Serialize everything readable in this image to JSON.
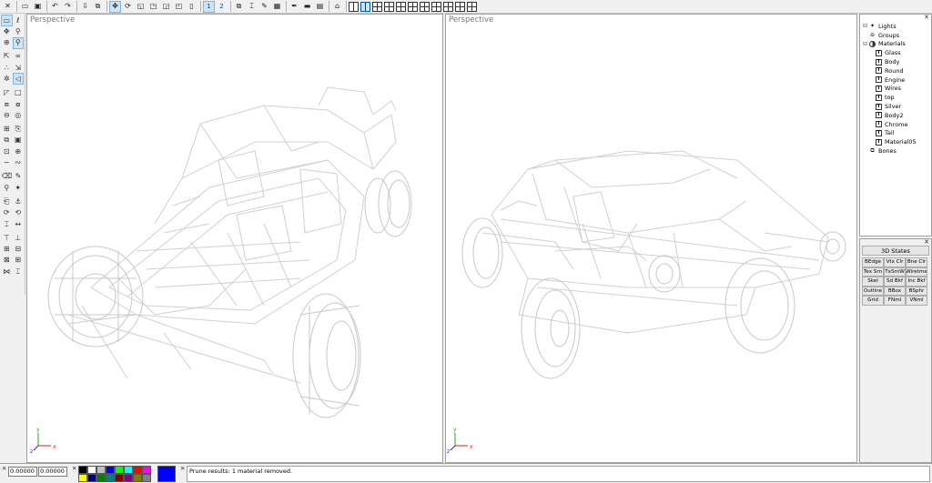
{
  "toolbar": {
    "icons": [
      "close-icon",
      "open-folder-icon",
      "save-icon",
      "undo-icon",
      "redo-icon",
      "import-icon",
      "export-icon",
      "move-icon",
      "rotate-icon",
      "scale-icon",
      "select-icon",
      "deselect-icon",
      "invert-icon",
      "info-icon"
    ],
    "buttons": [
      "1",
      "2"
    ],
    "active_view_button": "1"
  },
  "viewports": {
    "left": {
      "label": "Perspective"
    },
    "right": {
      "label": "Perspective"
    }
  },
  "scene_tree": {
    "lights": "Lights",
    "groups": "Groups",
    "materials": "Materials",
    "material_items": [
      "Glass",
      "Body",
      "Round",
      "Engine",
      "Wires",
      "top",
      "Silver",
      "Body2",
      "Chrome",
      "Tail",
      "Material05"
    ],
    "bones": "Bones"
  },
  "states": {
    "title": "3D States",
    "buttons": [
      "BEdge",
      "Vtx Clr",
      "Bne Clr",
      "Tex Srn",
      "TxSrnW",
      "Wiretme",
      "Skel",
      "Sd Bkf",
      "Inc Bkf",
      "Outline",
      "BBox",
      "BSphr",
      "Grid",
      "FNml",
      "VNml"
    ]
  },
  "status": {
    "coord_x": "0.00000",
    "coord_y": "0.00000",
    "message": "Prune results: 1 material removed.",
    "palette_colors": [
      "#000000",
      "#ffffff",
      "#c0c0c0",
      "#0000ff",
      "#00ff00",
      "#00ffff",
      "#ff0000",
      "#ff00ff",
      "#ffff00",
      "#000080",
      "#008000",
      "#008080",
      "#800000",
      "#800080",
      "#808000",
      "#808080"
    ],
    "current_color": "#0000ff"
  },
  "axis_labels": {
    "x": "x",
    "y": "y",
    "z": "z"
  }
}
